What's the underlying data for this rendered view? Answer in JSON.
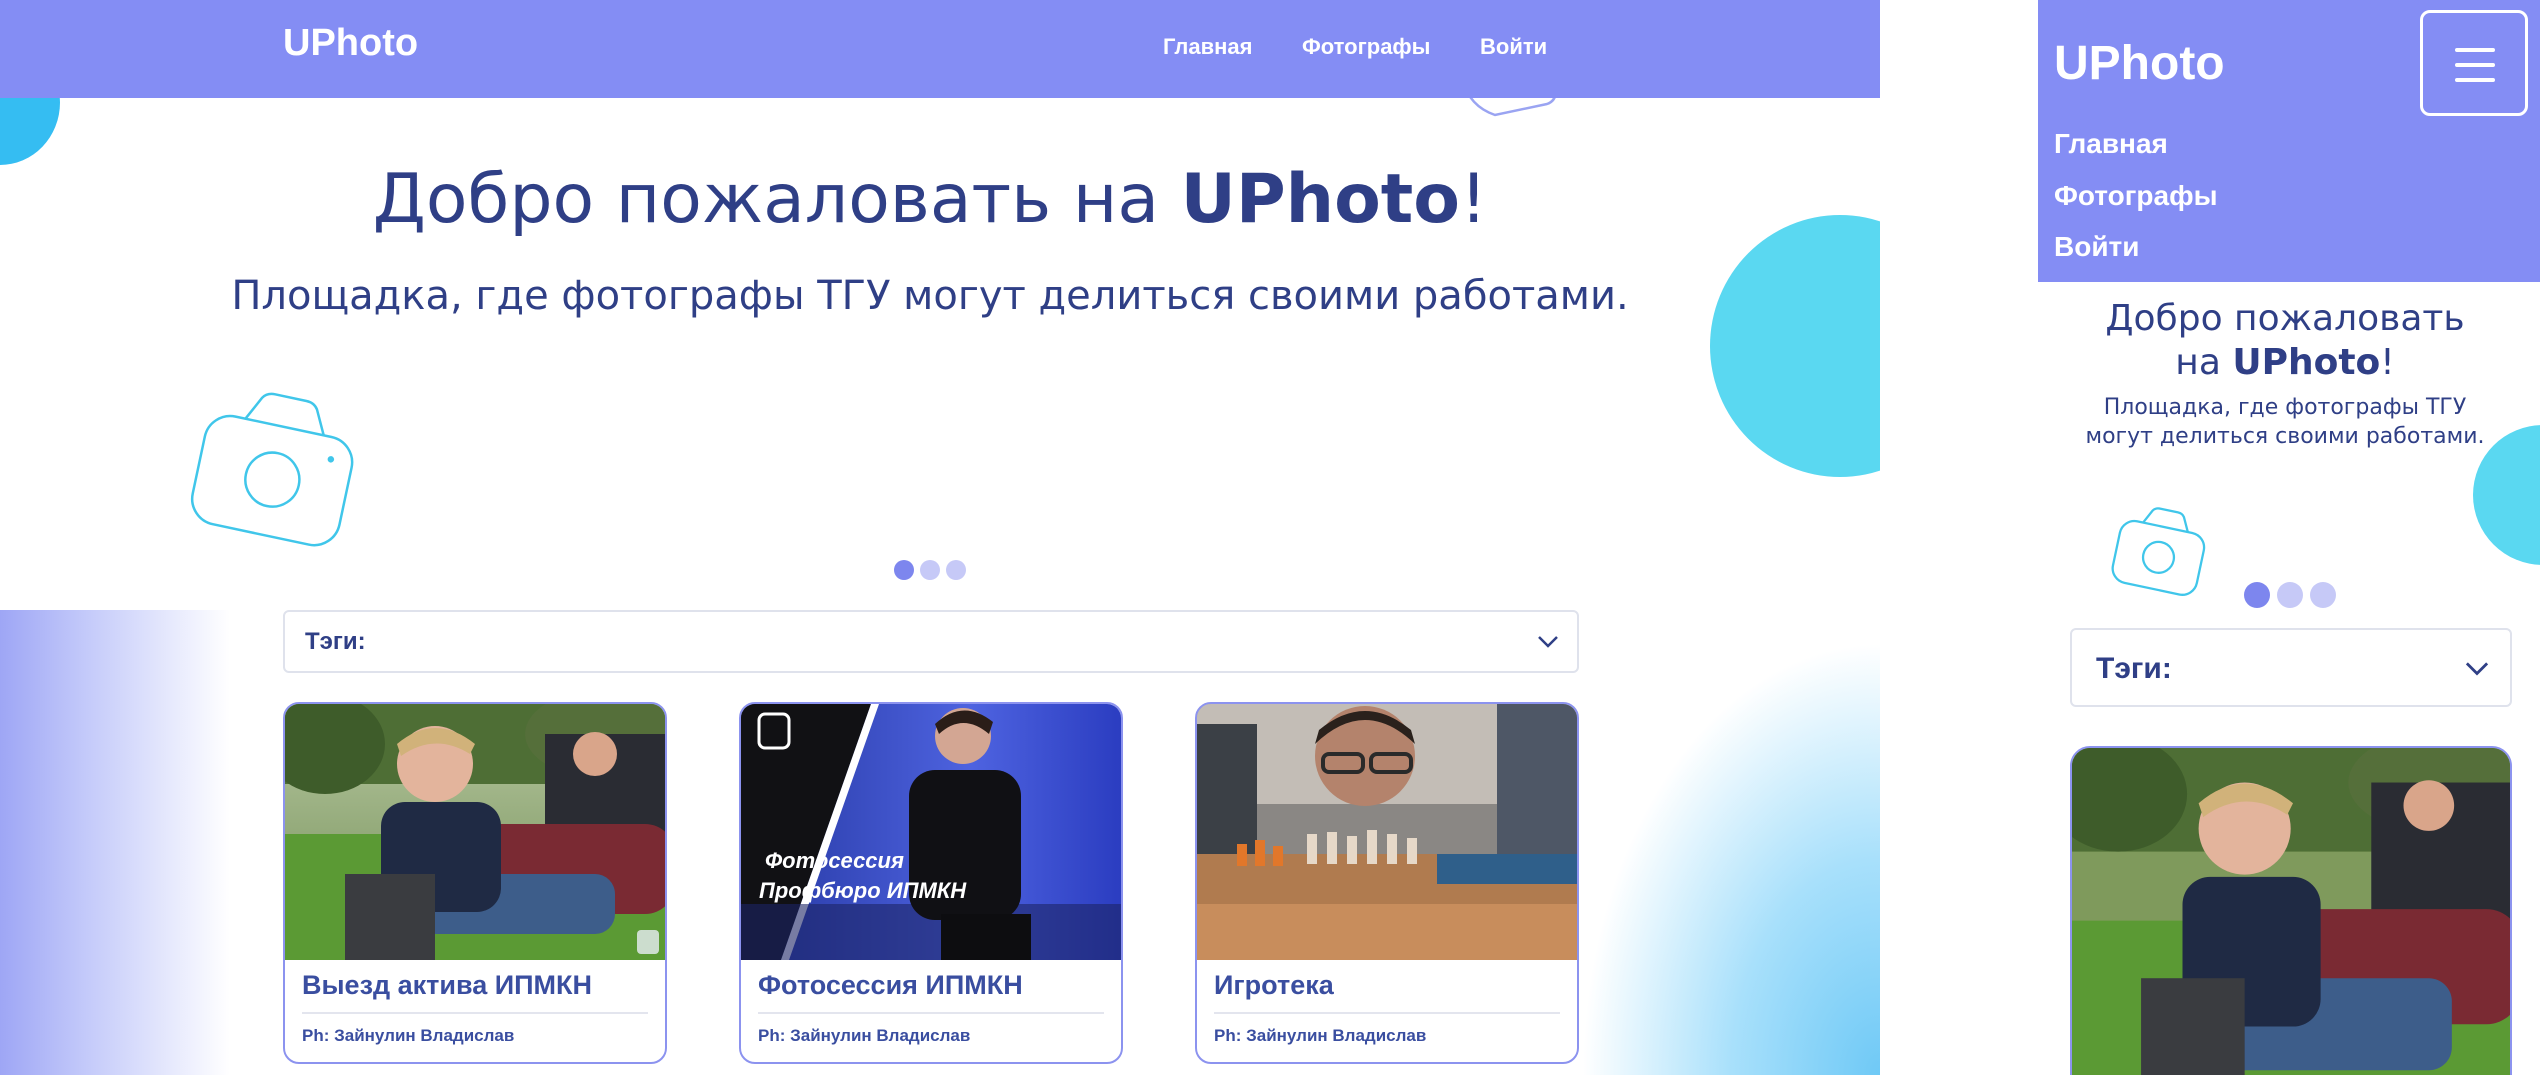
{
  "brand": {
    "name": "UPhoto"
  },
  "nav": {
    "links": [
      {
        "label": "Главная"
      },
      {
        "label": "Фотографы"
      },
      {
        "label": "Войти"
      }
    ]
  },
  "hero": {
    "title_prefix": "Добро пожаловать на ",
    "title_brand": "UPhoto",
    "title_suffix": "!",
    "title_line1": "Добро пожаловать",
    "title_line2_prefix": "на ",
    "subtitle": "Площадка, где фотографы ТГУ могут делиться своими работами.",
    "subtitle_line1": "Площадка, где фотографы ТГУ",
    "subtitle_line2": "могут делиться своими работами."
  },
  "carousel": {
    "slides": 3,
    "active": 1
  },
  "tags": {
    "label": "Тэги:"
  },
  "cards": [
    {
      "title": "Выезд актива ИПМКН",
      "credit": "Ph: Зайнулин Владислав"
    },
    {
      "title": "Фотосессия ИПМКН",
      "credit": "Ph: Зайнулин Владислав",
      "overlay_line1": "Фотосессия",
      "overlay_line2": "Профбюро ИПМКН"
    },
    {
      "title": "Игротека",
      "credit": "Ph: Зайнулин Владислав"
    }
  ],
  "colors": {
    "nav": "#848df4",
    "accent_cyan": "#5ad8f1",
    "text_dark": "#2f3f86",
    "card_border": "#8c93ef"
  },
  "icons": [
    "camera-outline-icon",
    "chevron-down-icon",
    "hamburger-menu-icon",
    "logo-badge-icon"
  ]
}
